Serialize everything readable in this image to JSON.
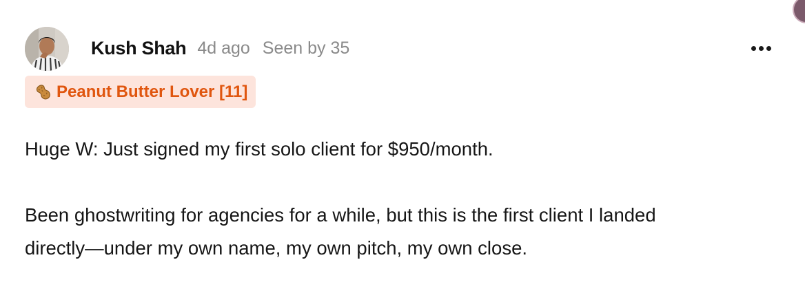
{
  "author": {
    "name": "Kush Shah",
    "posted_ago": "4d ago",
    "seen_by": "Seen by 35",
    "avatar_icon": "user-avatar-photo"
  },
  "badge": {
    "icon": "peanut-icon",
    "label": "Peanut Butter Lover [11]",
    "background": "#fde4dc",
    "text_color": "#e0560f"
  },
  "actions": {
    "more_icon": "more-horizontal-icon"
  },
  "post": {
    "paragraphs": [
      "Huge W: Just signed my first solo client for $950/month.",
      "Been ghostwriting for agencies for a while, but this is the first client I landed",
      "directly—under my own name, my own pitch, my own close."
    ]
  }
}
